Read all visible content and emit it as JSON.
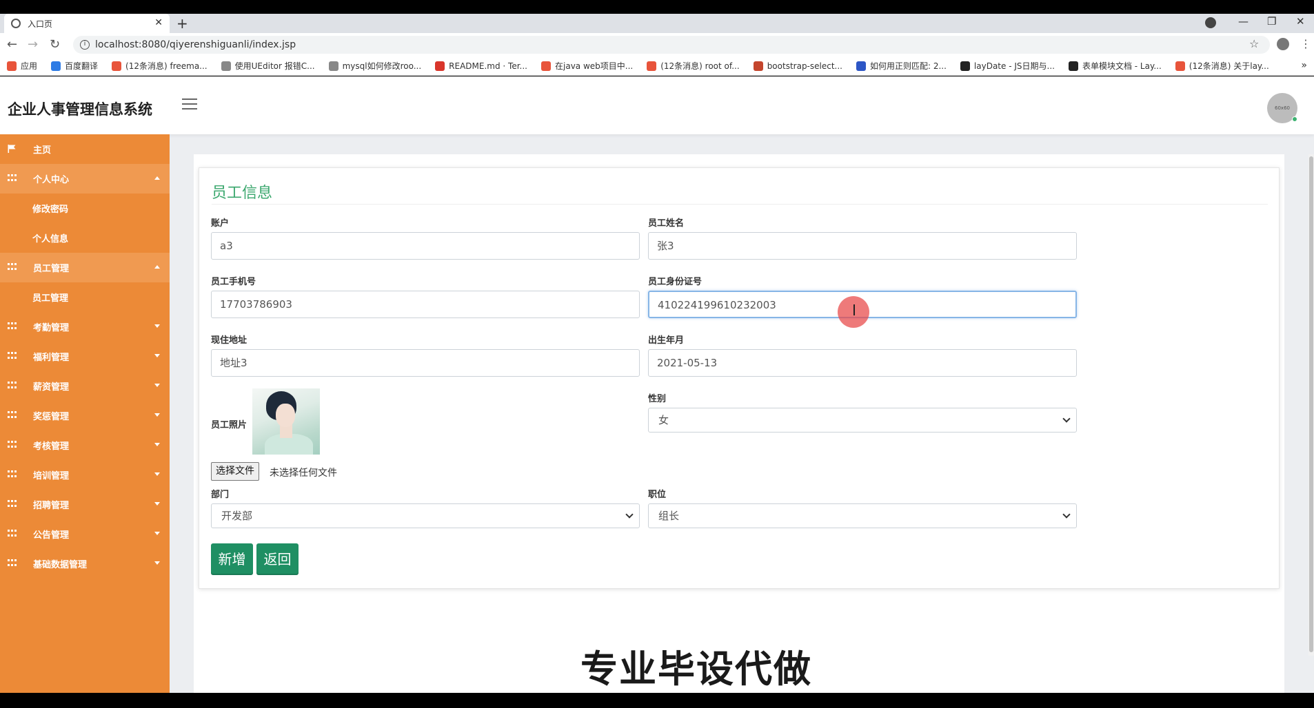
{
  "browser": {
    "tab_title": "入口页",
    "url": "localhost:8080/qiyerenshiguanli/index.jsp",
    "bookmarks": [
      {
        "label": "应用",
        "color": "#e8543b"
      },
      {
        "label": "百度翻译",
        "color": "#2d7be5"
      },
      {
        "label": "(12条消息) freema...",
        "color": "#e8543b"
      },
      {
        "label": "使用UEditor 报错C...",
        "color": "#888888"
      },
      {
        "label": "mysql如何修改roo...",
        "color": "#888888"
      },
      {
        "label": "README.md · Ter...",
        "color": "#d9362b"
      },
      {
        "label": "在java web项目中...",
        "color": "#e8543b"
      },
      {
        "label": "(12条消息) root of...",
        "color": "#e8543b"
      },
      {
        "label": "bootstrap-select...",
        "color": "#c4452d"
      },
      {
        "label": "如何用正则匹配: 2...",
        "color": "#2d56c5"
      },
      {
        "label": "layDate - JS日期与...",
        "color": "#222222"
      },
      {
        "label": "表单模块文档 - Lay...",
        "color": "#222222"
      },
      {
        "label": "(12条消息) 关于lay...",
        "color": "#e8543b"
      }
    ]
  },
  "app": {
    "title": "企业人事管理信息系统",
    "avatar_text": "60x60"
  },
  "sidebar": {
    "home": "主页",
    "items": [
      {
        "label": "个人中心",
        "expanded": true,
        "children": [
          "修改密码",
          "个人信息"
        ]
      },
      {
        "label": "员工管理",
        "expanded": true,
        "children": [
          "员工管理"
        ]
      },
      {
        "label": "考勤管理",
        "expanded": false,
        "children": []
      },
      {
        "label": "福利管理",
        "expanded": false,
        "children": []
      },
      {
        "label": "薪资管理",
        "expanded": false,
        "children": []
      },
      {
        "label": "奖惩管理",
        "expanded": false,
        "children": []
      },
      {
        "label": "考核管理",
        "expanded": false,
        "children": []
      },
      {
        "label": "培训管理",
        "expanded": false,
        "children": []
      },
      {
        "label": "招聘管理",
        "expanded": false,
        "children": []
      },
      {
        "label": "公告管理",
        "expanded": false,
        "children": []
      },
      {
        "label": "基础数据管理",
        "expanded": false,
        "children": []
      }
    ]
  },
  "form": {
    "title": "员工信息",
    "account_label": "账户",
    "account_value": "a3",
    "name_label": "员工姓名",
    "name_value": "张3",
    "phone_label": "员工手机号",
    "phone_value": "17703786903",
    "idcard_label": "员工身份证号",
    "idcard_value": "410224199610232003",
    "address_label": "现住地址",
    "address_value": "地址3",
    "birth_label": "出生年月",
    "birth_value": "2021-05-13",
    "photo_label": "员工照片",
    "file_button": "选择文件",
    "file_status": "未选择任何文件",
    "gender_label": "性别",
    "gender_value": "女",
    "dept_label": "部门",
    "dept_value": "开发部",
    "position_label": "职位",
    "position_value": "组长",
    "add_button": "新增",
    "back_button": "返回"
  },
  "overlay": {
    "watermark": "专业毕设代做"
  },
  "colors": {
    "sidebar": "#ec8a37",
    "accent_green": "#1f8f63",
    "title_green": "#3aa76d"
  }
}
